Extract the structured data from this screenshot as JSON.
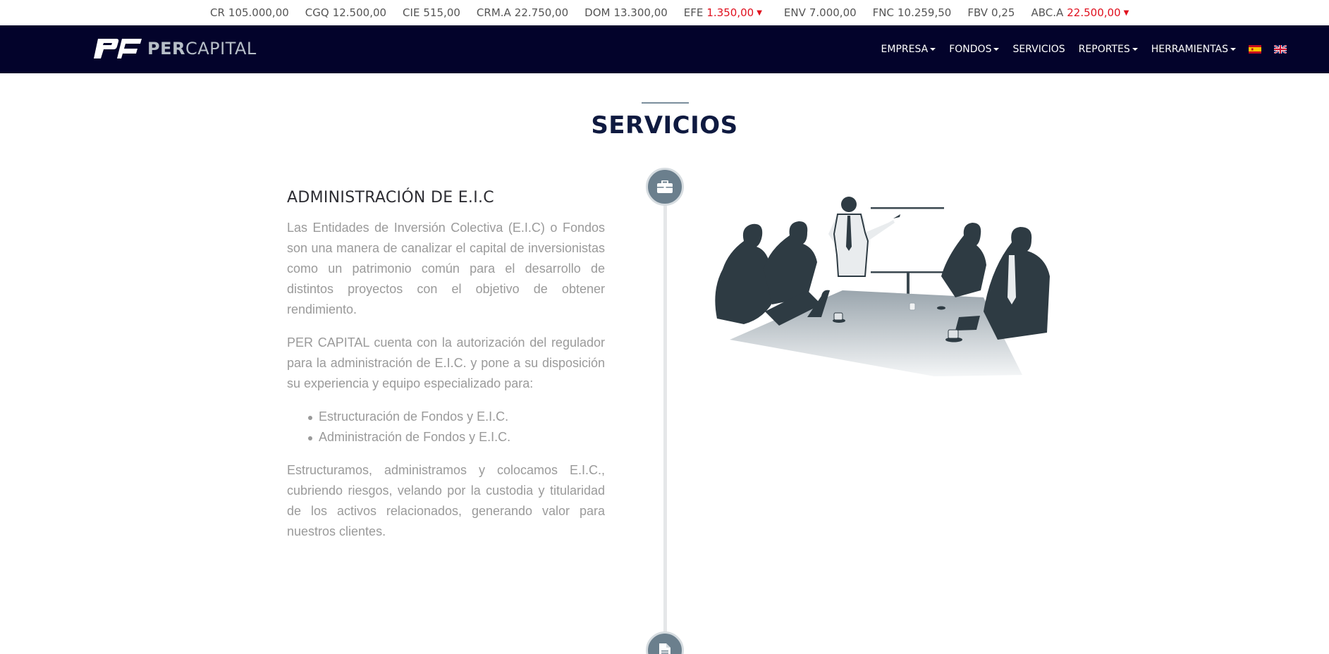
{
  "ticker": [
    {
      "symbol": "CR",
      "value": "105.000,00",
      "down": false
    },
    {
      "symbol": "CGQ",
      "value": "12.500,00",
      "down": false
    },
    {
      "symbol": "CIE",
      "value": "515,00",
      "down": false
    },
    {
      "symbol": "CRM.A",
      "value": "22.750,00",
      "down": false
    },
    {
      "symbol": "DOM",
      "value": "13.300,00",
      "down": false
    },
    {
      "symbol": "EFE",
      "value": "1.350,00",
      "down": true
    },
    {
      "symbol": "ENV",
      "value": "7.000,00",
      "down": false
    },
    {
      "symbol": "FNC",
      "value": "10.259,50",
      "down": false
    },
    {
      "symbol": "FBV",
      "value": "0,25",
      "down": false
    },
    {
      "symbol": "ABC.A",
      "value": "22.500,00",
      "down": true
    }
  ],
  "brand": {
    "bold": "PER",
    "light": "CAPITAL"
  },
  "nav": {
    "empresa": "EMPRESA",
    "fondos": "FONDOS",
    "servicios": "SERVICIOS",
    "reportes": "REPORTES",
    "herramientas": "HERRAMIENTAS"
  },
  "section": {
    "title": "SERVICIOS"
  },
  "service": {
    "title": "ADMINISTRACIÓN DE E.I.C",
    "p1": "Las Entidades de Inversión Colectiva (E.I.C) o Fondos son una manera de canalizar el capital de inversionistas como un patrimonio común para el desarrollo de distintos proyectos con el objetivo de obtener rendimiento.",
    "p2": "PER CAPITAL cuenta con la autorización del regulador para la administración de E.I.C. y pone a su disposición su experiencia y equipo especializado para:",
    "bullets": [
      "Estructuración de Fondos y E.I.C.",
      "Administración de Fondos y E.I.C."
    ],
    "p3": "Estructuramos, administramos y colocamos E.I.C., cubriendo riesgos, velando por la custodia y titularidad de los activos relacionados, generando valor para nuestros clientes."
  },
  "icons": {
    "top": "briefcase-icon",
    "bottom": "document-icon"
  },
  "colors": {
    "navbar": "#03032b",
    "ticker_down": "#e0101e",
    "timeline_icon": "#6b7f8d"
  }
}
